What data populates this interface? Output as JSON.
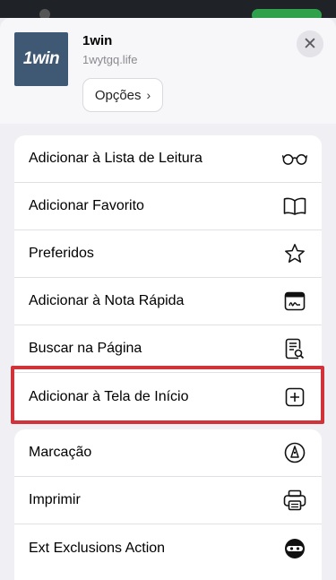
{
  "site": {
    "icon_text": "1win",
    "name": "1win",
    "url": "1wytgq.life",
    "options_label": "Opções"
  },
  "menu": {
    "group1": [
      {
        "label": "Adicionar à Lista de Leitura",
        "icon": "glasses-icon"
      },
      {
        "label": "Adicionar Favorito",
        "icon": "book-icon"
      },
      {
        "label": "Preferidos",
        "icon": "star-icon"
      },
      {
        "label": "Adicionar à Nota Rápida",
        "icon": "quick-note-icon"
      },
      {
        "label": "Buscar na Página",
        "icon": "find-in-page-icon"
      },
      {
        "label": "Adicionar à Tela de Início",
        "icon": "add-square-icon"
      }
    ],
    "group2": [
      {
        "label": "Marcação",
        "icon": "markup-icon"
      },
      {
        "label": "Imprimir",
        "icon": "printer-icon"
      },
      {
        "label": "Ext Exclusions Action",
        "icon": "ninja-icon"
      }
    ]
  },
  "colors": {
    "highlight": "#d0343a",
    "app_icon_bg": "#3f5873"
  }
}
